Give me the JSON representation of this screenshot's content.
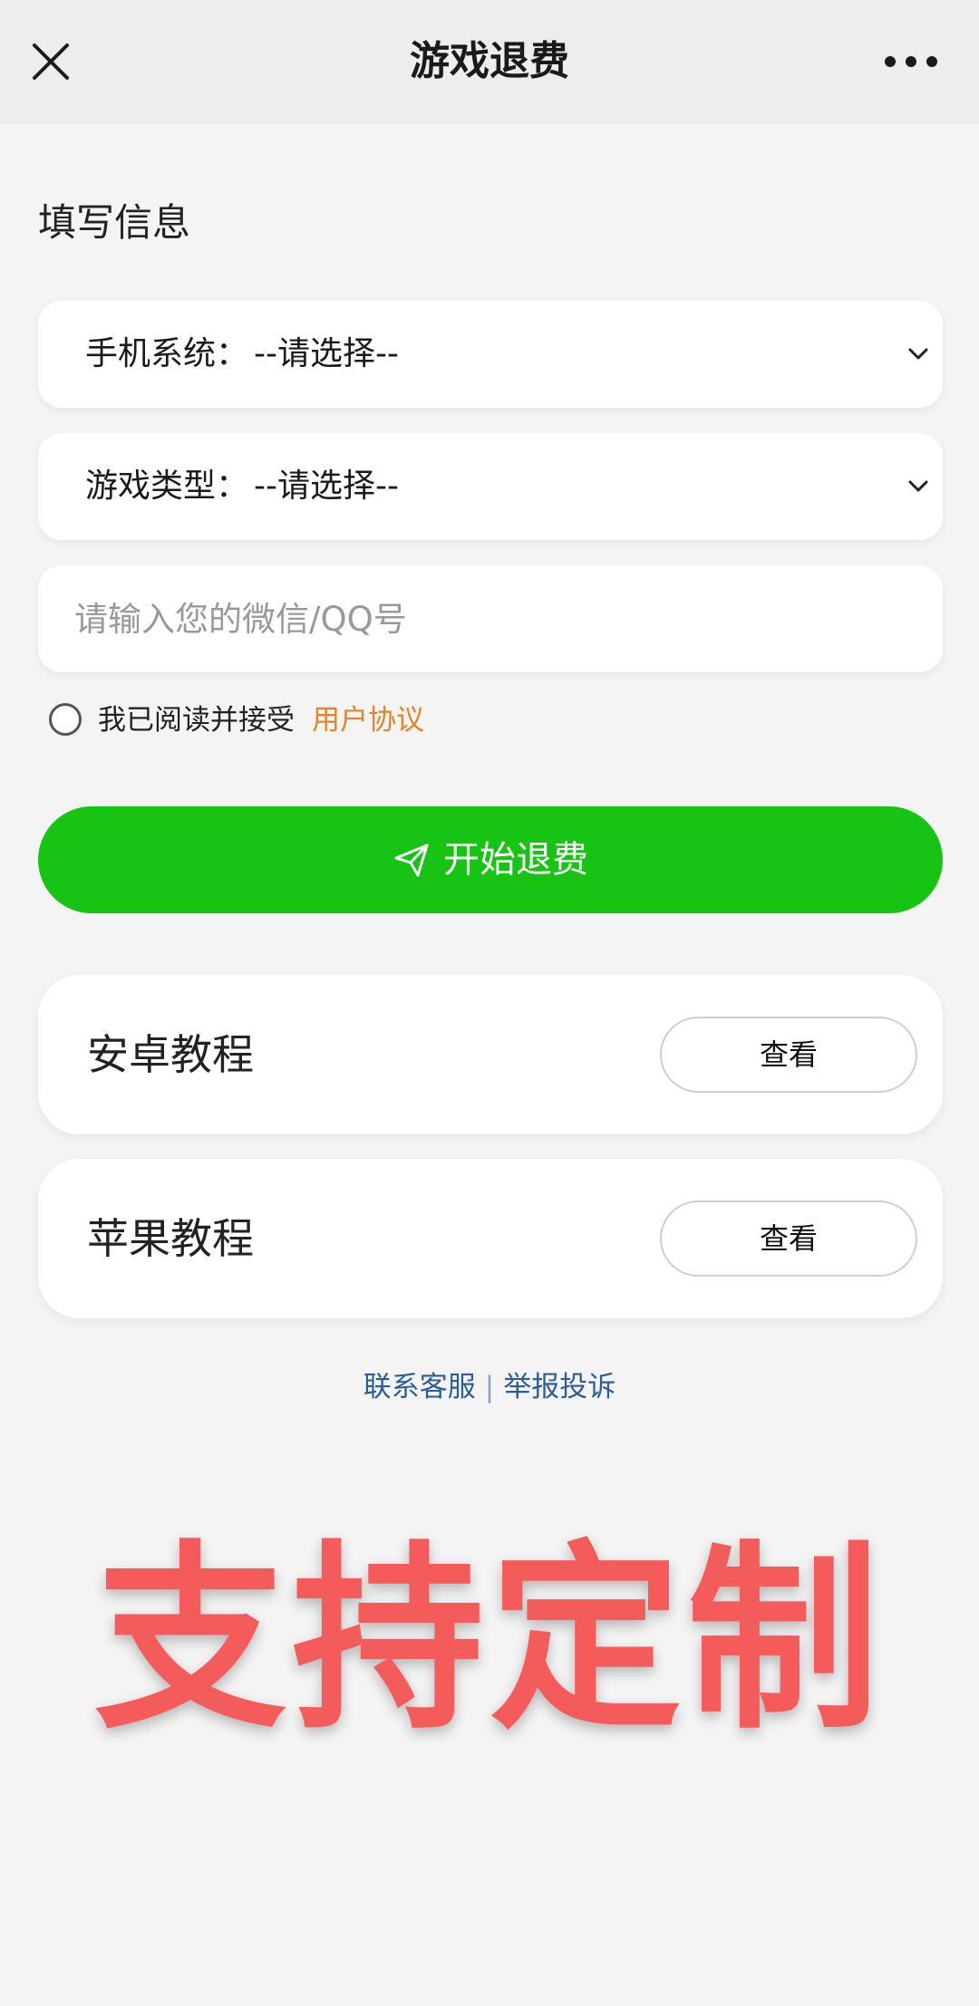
{
  "header": {
    "title": "游戏退费",
    "close_icon": "close-icon",
    "more_icon": "more-icon"
  },
  "form": {
    "section_title": "填写信息",
    "phone_system": {
      "label": "手机系统：",
      "selected": "--请选择--"
    },
    "game_type": {
      "label": "游戏类型：",
      "selected": "--请选择--"
    },
    "account_input": {
      "placeholder": "请输入您的微信/QQ号",
      "value": ""
    },
    "agreement": {
      "text": "我已阅读并接受",
      "link": "用户协议",
      "checked": false
    },
    "submit_label": "开始退费",
    "submit_icon": "send-icon"
  },
  "tutorials": [
    {
      "title": "安卓教程",
      "button": "查看"
    },
    {
      "title": "苹果教程",
      "button": "查看"
    }
  ],
  "footer": {
    "contact": "联系客服",
    "separator": "|",
    "report": "举报投诉"
  },
  "watermark": "支持定制",
  "colors": {
    "accent_green": "#17c413",
    "link_orange": "#e0852c",
    "footer_blue": "#2b5d9a",
    "watermark_red": "#f45c5c",
    "background": "#f4f4f4"
  }
}
